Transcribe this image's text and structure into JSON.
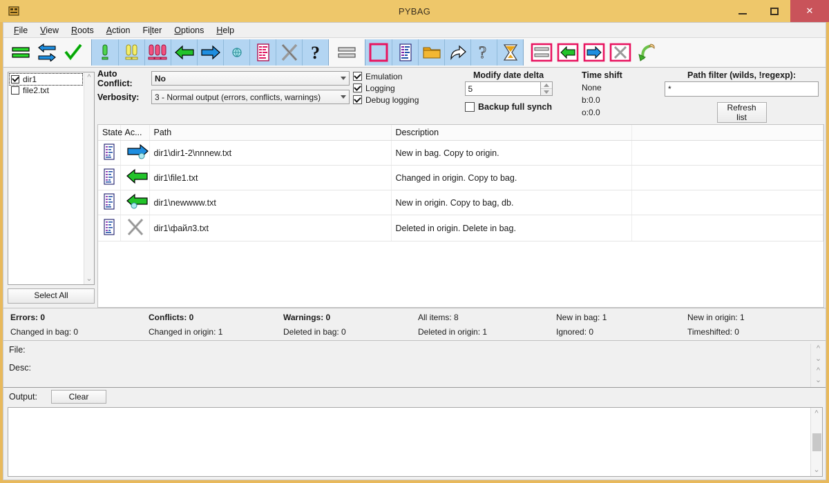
{
  "window": {
    "title": "PYBAG",
    "icon": "app-icon",
    "minimize_label": "–",
    "maximize_label": "□",
    "close_label": "✕"
  },
  "menubar": {
    "items": [
      {
        "label": "File",
        "accel": "F"
      },
      {
        "label": "View",
        "accel": "V"
      },
      {
        "label": "Roots",
        "accel": "R"
      },
      {
        "label": "Action",
        "accel": "A"
      },
      {
        "label": "Filter",
        "accel": "l"
      },
      {
        "label": "Options",
        "accel": "O"
      },
      {
        "label": "Help",
        "accel": "H"
      }
    ]
  },
  "toolbar": {
    "groups": [
      {
        "style": "plain",
        "buttons": [
          {
            "icon": "equals-green-icon",
            "name": "compare-button"
          },
          {
            "icon": "swap-arrows-icon",
            "name": "swap-roots-button"
          },
          {
            "icon": "green-check-icon",
            "name": "apply-check-button"
          }
        ]
      },
      {
        "style": "blue",
        "buttons": [
          {
            "icon": "one-exclamation-green-icon",
            "name": "verbosity-1-button"
          },
          {
            "icon": "two-exclamation-yellow-icon",
            "name": "verbosity-2-button"
          },
          {
            "icon": "three-exclamation-red-icon",
            "name": "verbosity-3-button"
          },
          {
            "icon": "green-left-arrow-icon",
            "name": "copy-to-bag-button"
          },
          {
            "icon": "blue-right-arrow-icon",
            "name": "copy-to-origin-button"
          },
          {
            "icon": "small-globe-icon",
            "name": "net-status-button"
          },
          {
            "icon": "document-lines-icon",
            "name": "show-log-button"
          },
          {
            "icon": "x-cross-grey-icon",
            "name": "delete-button"
          },
          {
            "icon": "question-mark-icon",
            "name": "help-button"
          }
        ]
      },
      {
        "style": "plain",
        "buttons": [
          {
            "icon": "equals-grey-icon",
            "name": "no-action-button"
          }
        ]
      },
      {
        "style": "blue",
        "buttons": [
          {
            "icon": "pink-square-outline-icon",
            "name": "select-none-button"
          },
          {
            "icon": "document-lines-icon",
            "name": "view-file-button"
          },
          {
            "icon": "folder-icon",
            "name": "open-folder-button"
          },
          {
            "icon": "share-arrow-icon",
            "name": "export-button"
          },
          {
            "icon": "question-outline-icon",
            "name": "unknown-state-button"
          },
          {
            "icon": "hourglass-icon",
            "name": "timeshift-button"
          }
        ]
      },
      {
        "style": "plain",
        "buttons": [
          {
            "icon": "equals-grey-pink-box-icon",
            "name": "filter-none-button"
          },
          {
            "icon": "green-left-arrow-pink-box-icon",
            "name": "filter-to-bag-button"
          },
          {
            "icon": "blue-right-arrow-pink-box-icon",
            "name": "filter-to-origin-button"
          },
          {
            "icon": "x-cross-pink-box-icon",
            "name": "filter-delete-button"
          },
          {
            "icon": "green-curved-arrow-icon",
            "name": "undo-button"
          }
        ]
      }
    ]
  },
  "tree": {
    "items": [
      {
        "label": "dir1",
        "checked": true,
        "focused": true
      },
      {
        "label": "file2.txt",
        "checked": false,
        "focused": false
      }
    ],
    "select_all_label": "Select All"
  },
  "options": {
    "auto_conflict_label": "Auto Conflict:",
    "auto_conflict_value": "No",
    "verbosity_label": "Verbosity:",
    "verbosity_value": "3 - Normal output (errors, conflicts, warnings)",
    "checkboxes": [
      {
        "label": "Emulation",
        "checked": true
      },
      {
        "label": "Logging",
        "checked": true
      },
      {
        "label": "Debug logging",
        "checked": true
      }
    ],
    "modify_date_delta_label": "Modify date delta",
    "modify_date_delta_value": "5",
    "backup_full_synch_label": "Backup full synch",
    "backup_full_synch_checked": false,
    "time_shift_label": "Time shift",
    "time_shift_lines": [
      "None",
      "b:0.0",
      "o:0.0"
    ],
    "path_filter_label": "Path filter (wilds, !regexp):",
    "path_filter_value": "*",
    "path_filter_placeholder": "",
    "refresh_label": "Refresh list"
  },
  "table": {
    "columns": [
      "State",
      "Ac...",
      "Path",
      "Description",
      ""
    ],
    "rows": [
      {
        "state_icon": "document-lines-icon",
        "action_icon": "blue-right-arrow-globe-icon",
        "path": "dir1\\dir1-2\\nnnew.txt",
        "description": "New in bag. Copy to origin.",
        "extra": ""
      },
      {
        "state_icon": "document-lines-icon",
        "action_icon": "green-left-arrow-icon",
        "path": "dir1\\file1.txt",
        "description": "Changed in origin. Copy to bag.",
        "extra": ""
      },
      {
        "state_icon": "document-lines-icon",
        "action_icon": "green-left-arrow-globe-icon",
        "path": "dir1\\newwww.txt",
        "description": "New in origin. Copy to bag, db.",
        "extra": ""
      },
      {
        "state_icon": "document-lines-icon",
        "action_icon": "x-cross-grey-icon",
        "path": "dir1\\файл3.txt",
        "description": "Deleted in origin. Delete in bag.",
        "extra": ""
      }
    ]
  },
  "stats": {
    "row1": [
      "Errors: 0",
      "Conflicts: 0",
      "Warnings: 0",
      "All items: 8",
      "New in bag: 1",
      "New in origin: 1"
    ],
    "row2": [
      "Changed in bag: 0",
      "Changed in origin: 1",
      "Deleted in bag: 0",
      "Deleted in origin: 1",
      "Ignored: 0",
      "Timeshifted: 0"
    ]
  },
  "detail": {
    "file_label": "File:",
    "file_value": "",
    "desc_label": "Desc:",
    "desc_value": ""
  },
  "output": {
    "label": "Output:",
    "clear_label": "Clear",
    "text": ""
  },
  "colors": {
    "title_bar": "#eec76a",
    "close_button": "#c9535a",
    "toolbar_group": "#b3d5f2",
    "accent_pink": "#e8145f",
    "green_arrow": "#22c32a",
    "blue_arrow": "#1e8ee0"
  }
}
